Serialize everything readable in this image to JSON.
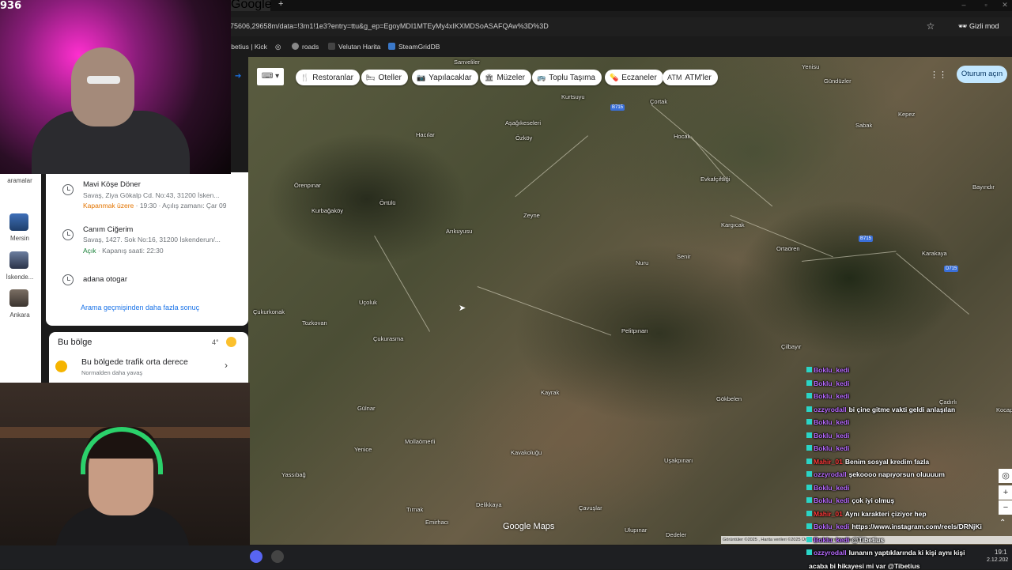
{
  "viewer_count": "936",
  "browser": {
    "tab_label": "Google",
    "url": "75606,29658m/data=!3m1!1e3?entry=ttu&g_ep=EgoyMDI1MTEyMy4xIKXMDSoASAFQAw%3D%3D",
    "incognito_label": "Gizli mod",
    "bookmarks": [
      "tibetius | Kick",
      "roads",
      "Velutan Harita",
      "SteamGridDB"
    ]
  },
  "map": {
    "filter_chips": [
      {
        "icon": "restaurant-icon",
        "glyph": "🍴",
        "label": "Restoranlar"
      },
      {
        "icon": "hotel-icon",
        "glyph": "🛏",
        "label": "Oteller"
      },
      {
        "icon": "camera-icon",
        "glyph": "📷",
        "label": "Yapılacaklar"
      },
      {
        "icon": "museum-icon",
        "glyph": "🏛",
        "label": "Müzeler"
      },
      {
        "icon": "transit-icon",
        "glyph": "🚌",
        "label": "Toplu Taşıma"
      },
      {
        "icon": "pharmacy-icon",
        "glyph": "💊",
        "label": "Eczaneler"
      },
      {
        "icon": "atm-icon",
        "glyph": "ATM",
        "label": "ATM'ler"
      }
    ],
    "sign_in_label": "Oturum açın",
    "logo": "Google Maps",
    "footer": "Görüntüler ©2025 , Harita verileri ©2025   Ürün Geri Bildirimi Gönder   2 km",
    "place_names": [
      "Sanveliler",
      "Kurtsuyu",
      "Çortak",
      "Yenisu",
      "Gündüzler",
      "Kepez",
      "Sabak",
      "Aşağıkeseleri",
      "Hacılar",
      "Özköy",
      "Hocalı",
      "Evkafçiftliği",
      "Bayındır",
      "Örenpınar",
      "Kurbağaköy",
      "Örtülü",
      "Zeyne",
      "Kargıcak",
      "Ortaören",
      "Karakaya",
      "Arıkuyusu",
      "Nuru",
      "Senir",
      "Çukurkonak",
      "Uçoluk",
      "Tozkovan",
      "Çukurasma",
      "Pelitpınarı",
      "Çilbayır",
      "Kayrak",
      "Gökbelen",
      "Çadırlı",
      "Gülnar",
      "Kocapınar",
      "Yenice",
      "Mollaömerli",
      "Kavakoluğu",
      "Uşakpınarı",
      "Yassıbağ",
      "Delikkaya",
      "Çavuşlar",
      "Tırnak",
      "Emirhacı",
      "Ulupınar",
      "Dedeler"
    ],
    "road_shields": [
      "B715",
      "B715",
      "D715"
    ]
  },
  "sidebar": {
    "partial_label": "aramalar",
    "recents": [
      {
        "label": "Mersin"
      },
      {
        "label": "İskende..."
      },
      {
        "label": "Ankara"
      }
    ]
  },
  "results": [
    {
      "title": "Mavi Köşe Döner",
      "address": "Savaş, Ziya Gökalp Cd. No:43, 31200 İsken...",
      "status_state": "Kapanmak üzere",
      "status_rest": " · 19:30 · Açılış zamanı: Çar 09",
      "status_color": "#e37400"
    },
    {
      "title": "Canım Ciğerim",
      "address": "Savaş, 1427. Sok No:16, 31200 İskenderun/...",
      "status_state": "Açık",
      "status_rest": " · Kapanış saati: 22:30",
      "status_color": "#188038"
    },
    {
      "title": "adana otogar",
      "address": "",
      "status_state": "",
      "status_rest": "",
      "status_color": "#188038"
    }
  ],
  "more_results_label": "Arama geçmişinden daha fazla sonuç",
  "area": {
    "title": "Bu bölge",
    "temp": "4°",
    "traffic_title": "Bu bölgede trafik orta derece",
    "traffic_sub": "Normalden daha yavaş"
  },
  "chat": [
    {
      "user": "Boklu_kedi",
      "color": "#b86bff",
      "msg": ""
    },
    {
      "user": "Boklu_kedi",
      "color": "#b86bff",
      "msg": ""
    },
    {
      "user": "Boklu_kedi",
      "color": "#b86bff",
      "msg": ""
    },
    {
      "user": "ozzyrodall",
      "color": "#b86bff",
      "msg": "bi çine gitme vakti geldi anlaşılan"
    },
    {
      "user": "Boklu_kedi",
      "color": "#b86bff",
      "msg": ""
    },
    {
      "user": "Boklu_kedi",
      "color": "#b86bff",
      "msg": ""
    },
    {
      "user": "Boklu_kedi",
      "color": "#b86bff",
      "msg": ""
    },
    {
      "user": "Mahir_01",
      "color": "#ff3b3b",
      "msg": "Benim sosyal kredim fazla"
    },
    {
      "user": "ozzyrodall",
      "color": "#b86bff",
      "msg": "şekoooo napıyorsun oluuuum"
    },
    {
      "user": "Boklu_kedi",
      "color": "#b86bff",
      "msg": ""
    },
    {
      "user": "Boklu_kedi",
      "color": "#b86bff",
      "msg": "çok iyi olmuş"
    },
    {
      "user": "Mahir_01",
      "color": "#ff3b3b",
      "msg": "Aynı karakteri çiziyor hep"
    },
    {
      "user": "Boklu_kedi",
      "color": "#b86bff",
      "msg": "https://www.instagram.com/reels/DRNjKi"
    },
    {
      "user": "Boklu_kedi",
      "color": "#b86bff",
      "msg": "@Tibetius"
    },
    {
      "user": "ozzyrodall",
      "color": "#b86bff",
      "msg": "lunanın yaptıklarında ki kişi aynı kişi"
    },
    {
      "user": "",
      "color": "#b86bff",
      "msg": "acaba bi hikayesi mi var @Tibetius"
    }
  ],
  "clock": {
    "time": "19:1",
    "date": "2.12.202"
  }
}
